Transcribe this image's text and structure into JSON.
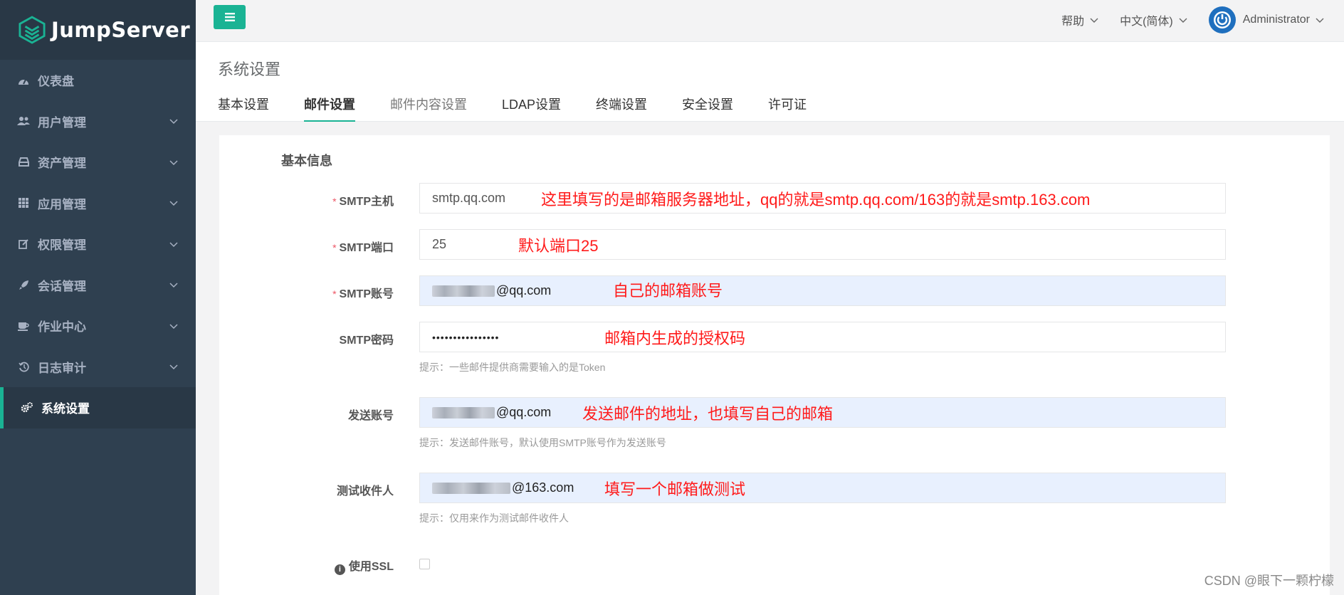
{
  "brand": {
    "name": "JumpServer"
  },
  "colors": {
    "sidebar_bg": "#2f4050",
    "accent": "#1ab394",
    "annotation": "#ff1a1a",
    "autofill_bg": "#e8f0fe"
  },
  "sidebar": {
    "items": [
      {
        "label": "仪表盘",
        "icon": "dashboard-icon"
      },
      {
        "label": "用户管理",
        "icon": "users-icon"
      },
      {
        "label": "资产管理",
        "icon": "inbox-icon"
      },
      {
        "label": "应用管理",
        "icon": "grid-icon"
      },
      {
        "label": "权限管理",
        "icon": "edit-icon"
      },
      {
        "label": "会话管理",
        "icon": "rocket-icon"
      },
      {
        "label": "作业中心",
        "icon": "coffee-icon"
      },
      {
        "label": "日志审计",
        "icon": "history-icon"
      },
      {
        "label": "系统设置",
        "icon": "gears-icon"
      }
    ]
  },
  "topbar": {
    "help": "帮助",
    "language": "中文(简体)",
    "user": "Administrator"
  },
  "page": {
    "title": "系统设置",
    "tabs": [
      "基本设置",
      "邮件设置",
      "邮件内容设置",
      "LDAP设置",
      "终端设置",
      "安全设置",
      "许可证"
    ]
  },
  "form": {
    "section_title": "基本信息",
    "smtp_host": {
      "label": "SMTP主机",
      "value": "smtp.qq.com"
    },
    "smtp_port": {
      "label": "SMTP端口",
      "value": "25"
    },
    "smtp_account": {
      "label": "SMTP账号",
      "value": "@qq.com"
    },
    "smtp_password": {
      "label": "SMTP密码",
      "value": "••••••••••••••••",
      "help": "提示：一些邮件提供商需要输入的是Token"
    },
    "sender": {
      "label": "发送账号",
      "value": "@qq.com",
      "help": "提示：发送邮件账号，默认使用SMTP账号作为发送账号"
    },
    "test_recipient": {
      "label": "测试收件人",
      "value": "@163.com",
      "help": "提示：仅用来作为测试邮件收件人"
    },
    "use_ssl": {
      "label": "使用SSL"
    }
  },
  "annotations": {
    "host": "这里填写的是邮箱服务器地址，qq的就是smtp.qq.com/163的就是smtp.163.com",
    "port": "默认端口25",
    "account": "自己的邮箱账号",
    "password": "邮箱内生成的授权码",
    "sender": "发送邮件的地址，也填写自己的邮箱",
    "recipient": "填写一个邮箱做测试"
  },
  "watermark": "CSDN @眼下一颗柠檬"
}
